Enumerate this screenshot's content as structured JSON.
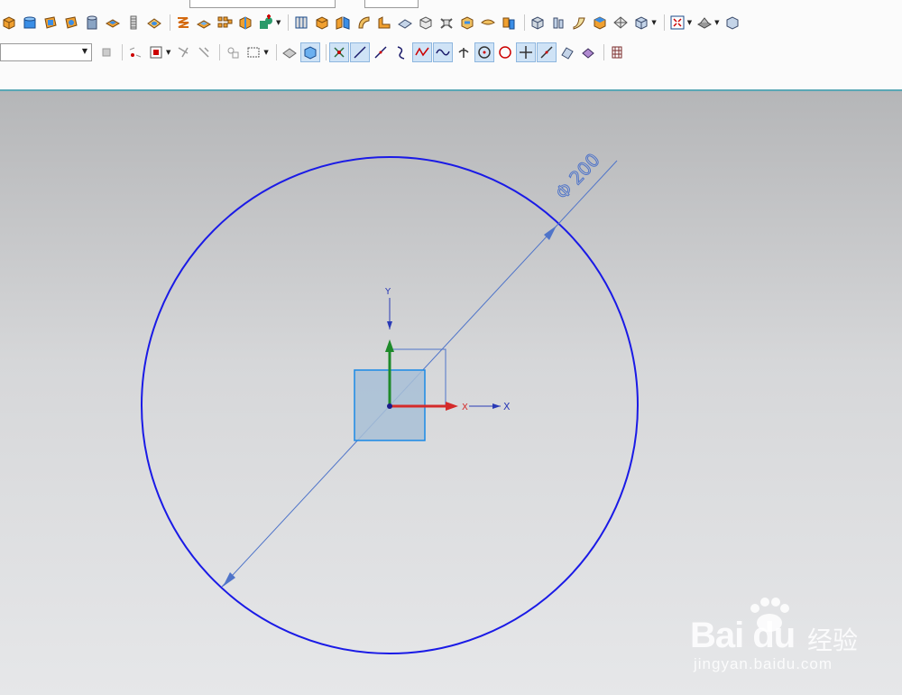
{
  "toolbar": {
    "row1_icons": [
      "block-icon",
      "cylinder-icon",
      "cone-icon",
      "sphere-icon",
      "tube-icon",
      "extrude-icon",
      "thread-icon",
      "hole-icon",
      "datum-plane-icon",
      "pattern-icon",
      "array-icon",
      "feature-icon",
      "boolean-icon",
      "cabinet-icon",
      "box-icon",
      "mirror-icon",
      "sweep-icon",
      "flange-icon",
      "surface-icon",
      "chamfer-icon",
      "bend-icon",
      "offset-icon",
      "draft-icon",
      "trim-icon",
      "blend-icon",
      "view-cube-icon",
      "view-cylinder-icon",
      "sheet-icon",
      "shade-icon",
      "edge-icon",
      "orient-icon",
      "fit-icon",
      "render-icon"
    ],
    "row2_combo_value": "",
    "row2_icons": [
      "snap-point-icon",
      "select-filter-icon",
      "select-icon",
      "move-icon",
      "selection-box-icon",
      "view-solid-icon",
      "view-wire-icon",
      "snap-end-icon",
      "snap-line-icon",
      "snap-line2-icon",
      "snap-curve-icon",
      "snap-spline-icon",
      "snap-wave-icon",
      "snap-perp-icon",
      "snap-center-icon",
      "snap-quadrant-icon",
      "snap-intersect-icon",
      "snap-point-on-icon",
      "snap-face-icon",
      "snap-bounded-icon",
      "grid-icon"
    ]
  },
  "drawing": {
    "dimension_text": "Φ 200",
    "axis_x_label": "X",
    "axis_y_label": "Y",
    "wcs_x_label": "X",
    "wcs_y_label": "Y",
    "circle_color": "#1a1ae6",
    "dimension_color": "#4f74c9",
    "axis_x_color": "#d42a2a",
    "axis_y_color": "#1e8a2a",
    "csys_fill": "#a8bfd6"
  },
  "watermark": {
    "brand": "Bai du",
    "cn": "经验",
    "url": "jingyan.baidu.com"
  }
}
